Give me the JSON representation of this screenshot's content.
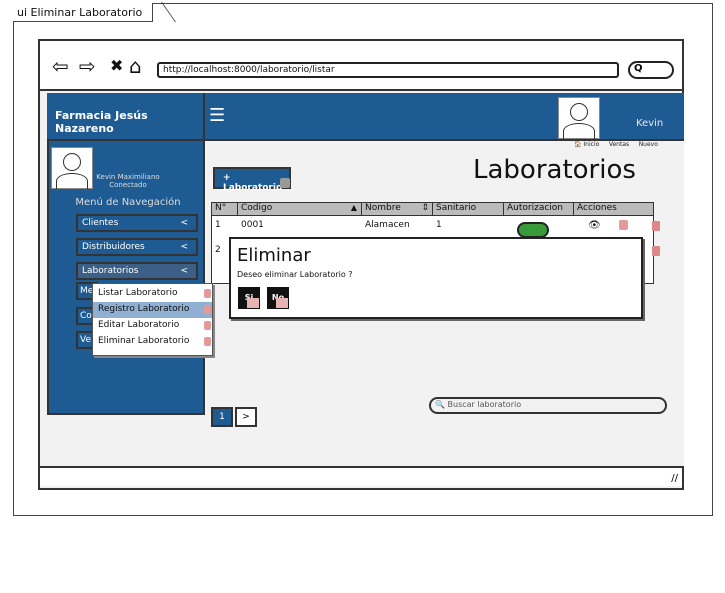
{
  "window": {
    "title": "ui Eliminar Laboratorio"
  },
  "browser": {
    "back": "⇦",
    "forward": "⇨",
    "stop": "✖",
    "home": "⌂",
    "url": "http://localhost:8000/laboratorio/listar",
    "search_icon": "Q"
  },
  "header": {
    "brand": "Farmacia Jesús Nazareno",
    "menu_icon": "☰",
    "user": "Kevin"
  },
  "sidebar": {
    "user_name": "Kevin Maximiliano",
    "user_status": "Conectado",
    "menu_title": "Menú de Navegación",
    "items": [
      {
        "label": "Clientes",
        "chevron": "<"
      },
      {
        "label": "Distribuidores",
        "chevron": "<"
      },
      {
        "label": "Laboratorios",
        "chevron": "<"
      }
    ],
    "stubs": [
      "Me",
      "Co",
      "Ve"
    ],
    "submenu": [
      "Listar Laboratorio",
      "Registro Laboratorio",
      "Editar Laboratorio",
      "Eliminar Laboratorio"
    ]
  },
  "main": {
    "breadcrumbs": [
      "Inicio",
      "Ventas",
      "Nuevo"
    ],
    "title": "Laboratorios",
    "add_button": "+ Laboratorio",
    "table": {
      "headers": [
        "N°",
        "Codigo",
        "Nombre",
        "Sanitario",
        "Autorizacion",
        "Acciones"
      ],
      "rows": [
        {
          "n": "1",
          "codigo": "0001",
          "nombre": "Alamacen",
          "sanitario": "1"
        },
        {
          "n": "2",
          "codigo": "",
          "nombre": "",
          "sanitario": ""
        }
      ],
      "sort_up": "▲",
      "sort_both": "⇕",
      "view_icon": "👁"
    },
    "pager": [
      "1",
      ">"
    ],
    "search_placeholder": "Buscar laboratorio"
  },
  "modal": {
    "title": "Eliminar",
    "text": "Deseo eliminar Laboratorio ?",
    "yes": "Si",
    "no": "No"
  },
  "colors": {
    "brand_blue": "#1f5b93",
    "toggle_green": "#3a9a3a"
  }
}
